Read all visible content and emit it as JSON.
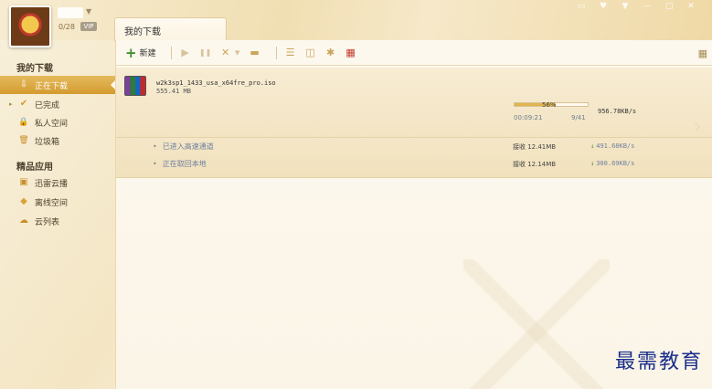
{
  "user": {
    "level": "0/28",
    "vip_label": "VIP"
  },
  "tab": {
    "label": "我的下载"
  },
  "window_controls": [
    "▭",
    "♥",
    "▼",
    "—",
    "□",
    "✕"
  ],
  "sidebar": {
    "section1": "我的下载",
    "items": [
      {
        "label": "正在下载",
        "icon": "download-icon",
        "glyph": "⇩"
      },
      {
        "label": "已完成",
        "icon": "check-icon",
        "glyph": "✔"
      },
      {
        "label": "私人空间",
        "icon": "lock-icon",
        "glyph": "🔒"
      },
      {
        "label": "垃圾箱",
        "icon": "trash-icon",
        "glyph": "🗑"
      }
    ],
    "section2": "精品应用",
    "apps": [
      {
        "label": "迅雷云播",
        "icon": "cloud-play-icon",
        "glyph": "▣"
      },
      {
        "label": "离线空间",
        "icon": "offline-space-icon",
        "glyph": "◆"
      },
      {
        "label": "云列表",
        "icon": "cloud-list-icon",
        "glyph": "☁"
      }
    ]
  },
  "toolbar": {
    "new_label": "新建",
    "icons": [
      {
        "name": "play-icon",
        "glyph": "▶",
        "dim": true
      },
      {
        "name": "pause-icon",
        "glyph": "❚❚",
        "dim": true
      },
      {
        "name": "delete-icon",
        "glyph": "✕",
        "dim": false
      },
      {
        "name": "delete-dropdown-icon",
        "glyph": "▾",
        "dim": true
      },
      {
        "name": "folder-icon",
        "glyph": "▬",
        "dim": false
      },
      {
        "name": "sort-icon",
        "glyph": "☰",
        "dim": false
      },
      {
        "name": "details-icon",
        "glyph": "◫",
        "dim": false
      },
      {
        "name": "settings-icon",
        "glyph": "✱",
        "dim": false
      },
      {
        "name": "shop-icon",
        "glyph": "▦",
        "dim": false
      }
    ],
    "grid_glyph": "▦"
  },
  "task": {
    "file_name": "w2k3sp1_1433_usa_x64fre_pro.iso",
    "file_size": "555.41 MB",
    "progress": 0.56,
    "progress_text": "56%",
    "elapsed": "00:09:21",
    "pieces": "9/41",
    "speed": "956.78KB/s",
    "channels": [
      {
        "label": "已进入高速通道",
        "recv": "接收 12.41MB",
        "speed": "491.68KB/s"
      },
      {
        "label": "正在取回本地",
        "recv": "接收 12.14MB",
        "speed": "300.69KB/s"
      }
    ]
  },
  "watermark": "最需教育"
}
